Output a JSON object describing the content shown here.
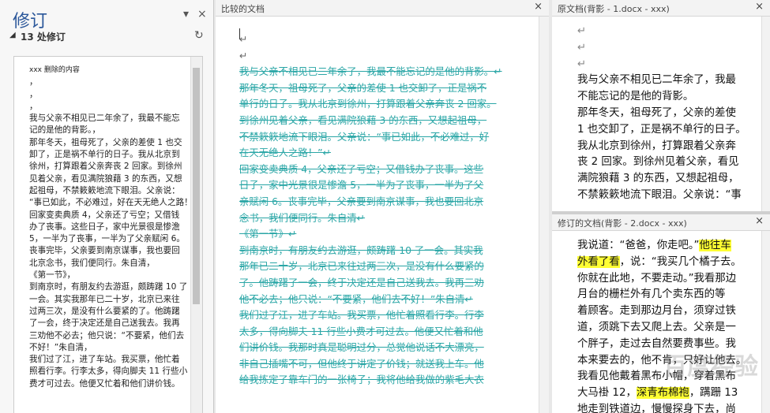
{
  "revisions_pane": {
    "title": "修订",
    "close": "×",
    "dropdown": "▾",
    "count_label": "13 处修订",
    "refresh": "↻",
    "collapse": "◢",
    "deleted_label": "xxx 删除的内容",
    "lines": [
      "，",
      "，",
      "，",
      "我与父亲不相见已二年余了，我最不能忘",
      "记的是他的背影。，",
      "那年冬天，祖母死了，父亲的差使 1 也交",
      "卸了，正是祸不单行的日子。我从北京到",
      "徐州，打算跟着父亲奔丧 2 回家。到徐州",
      "见着父亲，看见满院狼藉 3 的东西，又想",
      "起祖母，不禁簌簌地流下眼泪。父亲说：",
      "“事已如此，不必难过，好在天无绝人之路！”，",
      "回家变卖典质 4，父亲还了亏空；又借钱",
      "办了丧事。这些日子，家中光景很是惨澹",
      "5，一半为了丧事，一半为了父亲赋闲 6。",
      "丧事完毕，父亲要到南京谋事，我也要回",
      "北京念书，我们便同行。朱自清，",
      "",
      "《第一节》，",
      "",
      "到南京时，有朋友约去游逛，颇踌躇 10 了",
      "一会。其实我那年已二十岁，北京已来往",
      "过两三次，是没有什么要紧的了。他踌躇",
      "了一会，终于决定还是自己送我去。我再",
      "三劝他不必去；他只说：“不要紧，他们去",
      "不好！”朱自清，",
      "我们过了江，进了车站。我买票，他忙着",
      "照看行李。行李太多，得向脚夫 11 行些小",
      "费才可过去。他便又忙着和他们讲价钱。"
    ]
  },
  "compared": {
    "title": "比较的文档",
    "close": "×",
    "lines": [
      "↵",
      "↵",
      "",
      "我与父亲不相见已二年余了，我最不能忘记的是他的背影。↵",
      "那年冬天，祖母死了，父亲的差使 1 也交卸了，正是祸不",
      "单行的日子。我从北京到徐州，打算跟着父亲奔丧 2 回家。",
      "到徐州见着父亲，看见满院狼藉 3 的东西，又想起祖母，",
      "不禁簌簌地流下眼泪。父亲说：“事已如此，不必难过，好",
      "在天无绝人之路！”↵",
      "回家变卖典质 4，父亲还了亏空；又借钱办了丧事。这些",
      "日子，家中光景很是惨澹 5，一半为了丧事，一半为了父",
      "亲赋闲 6。丧事完毕，父亲要到南京谋事，我也要回北京",
      "念书，我们便同行。朱自清↵",
      "",
      "《第一节》↵",
      "",
      "到南京时，有朋友约去游逛，颇踌躇 10 了一会。其实我",
      "那年已二十岁，北京已来往过两三次，是没有什么要紧的",
      "了。他踌躇了一会，终于决定还是自己送我去。我再三劝",
      "他不必去；他只说：“不要紧，他们去不好！”朱自清↵",
      "我们过了江，进了车站。我买票，他忙着照看行李。行李",
      "太多，得向脚夫 11 行些小费才可过去。他便又忙着和他",
      "们讲价钱。我那时真是聪明过分，总觉他说话不大漂亮，",
      "非自己插嘴不可，但他终于讲定了价钱；就送我上车。他",
      "给我拣定了靠车门的一张椅子；我将他给我做的紫毛大衣"
    ]
  },
  "original": {
    "title": "原文档(背影 - 1.docx - xxx)",
    "close": "×",
    "lines": [
      "↵",
      "↵",
      "↵",
      "我与父亲不相见已二年余了，我最",
      "不能忘记的是他的背影。",
      "那年冬天，祖母死了，父亲的差使",
      "1 也交卸了，正是祸不单行的日子。",
      "我从北京到徐州，打算跟着父亲奔",
      "丧 2 回家。到徐州见着父亲，看见",
      "满院狼藉 3 的东西，又想起祖母，",
      "不禁簌簌地流下眼泪。父亲说：“事"
    ]
  },
  "modified": {
    "title": "修订的文档(背影 - 2.docx - xxx)",
    "close": "×",
    "l1a": "我说道：“爸爸，你走吧。”",
    "l1h": "他往车",
    "l2h": "外看了看",
    "l2b": "，说：“我买几个橘子去。",
    "lines": [
      "你就在此地，不要走动。”我看那边",
      "月台的栅栏外有几个卖东西的等",
      "着顾客。走到那边月台，须穿过铁",
      "道，须跳下去又爬上去。父亲是一",
      "个胖子，走过去自然要费事些。我",
      "本来要去的，他不肯，只好让他去。",
      "我看见他戴着黑布小帽，穿着黑布"
    ],
    "l10a": "大马褂 12，",
    "l10h": "深青布棉袍",
    "l10b": "，蹒跚 13",
    "l11": "地走到铁道边，慢慢探身下去，尚"
  },
  "watermark": "百度经验"
}
